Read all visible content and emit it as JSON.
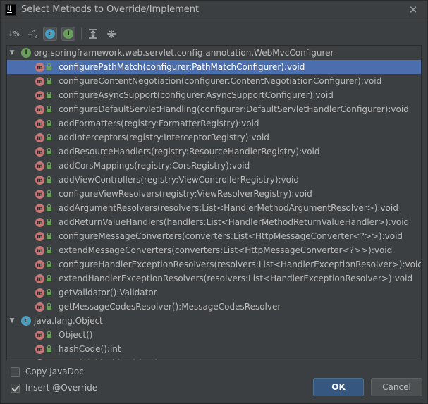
{
  "window": {
    "title": "Select Methods to Override/Implement",
    "app_icon_letters": "IJ"
  },
  "toolbar": {
    "buttons": [
      {
        "name": "sort-by-visibility",
        "label": "↓%",
        "active": false
      },
      {
        "name": "sort-alphabetically",
        "label": "↓ᵃz",
        "active": false
      },
      {
        "name": "show-classes",
        "label": "c",
        "active": true
      },
      {
        "name": "show-interfaces",
        "label": "I",
        "active": true
      },
      {
        "name": "expand-all",
        "label": "⇊",
        "active": false
      },
      {
        "name": "collapse-all",
        "label": "⇈",
        "active": false
      }
    ]
  },
  "tree": {
    "groups": [
      {
        "name": "org.springframework.web.servlet.config.annotation.WebMvcConfigurer",
        "kind": "interface",
        "icon_letter": "I",
        "icon_color": "#6a9f5b",
        "expanded": true,
        "methods": [
          "configurePathMatch(configurer:PathMatchConfigurer):void",
          "configureContentNegotiation(configurer:ContentNegotiationConfigurer):void",
          "configureAsyncSupport(configurer:AsyncSupportConfigurer):void",
          "configureDefaultServletHandling(configurer:DefaultServletHandlerConfigurer):void",
          "addFormatters(registry:FormatterRegistry):void",
          "addInterceptors(registry:InterceptorRegistry):void",
          "addResourceHandlers(registry:ResourceHandlerRegistry):void",
          "addCorsMappings(registry:CorsRegistry):void",
          "addViewControllers(registry:ViewControllerRegistry):void",
          "configureViewResolvers(registry:ViewResolverRegistry):void",
          "addArgumentResolvers(resolvers:List<HandlerMethodArgumentResolver>):void",
          "addReturnValueHandlers(handlers:List<HandlerMethodReturnValueHandler>):void",
          "configureMessageConverters(converters:List<HttpMessageConverter<?>>):void",
          "extendMessageConverters(converters:List<HttpMessageConverter<?>>):void",
          "configureHandlerExceptionResolvers(resolvers:List<HandlerExceptionResolver>):void",
          "extendHandlerExceptionResolvers(resolvers:List<HandlerExceptionResolver>):void",
          "getValidator():Validator",
          "getMessageCodesResolver():MessageCodesResolver"
        ]
      },
      {
        "name": "java.lang.Object",
        "kind": "class",
        "icon_letter": "c",
        "icon_color": "#4a9fc0",
        "expanded": true,
        "methods": [
          "Object()",
          "hashCode():int",
          "equals(obj:Object):boolean"
        ]
      }
    ],
    "selected_method": "configurePathMatch(configurer:PathMatchConfigurer):void",
    "method_icon_letter": "m"
  },
  "options": {
    "copy_javadoc": {
      "label": "Copy JavaDoc",
      "checked": false
    },
    "insert_override": {
      "label": "Insert @Override",
      "checked": true
    }
  },
  "buttons": {
    "ok": "OK",
    "cancel": "Cancel"
  },
  "colors": {
    "background": "#3c3f41",
    "selection": "#4b6eaf",
    "method_icon": "#c67777",
    "lock_icon": "#6a9f5b",
    "ok_button": "#365880"
  }
}
